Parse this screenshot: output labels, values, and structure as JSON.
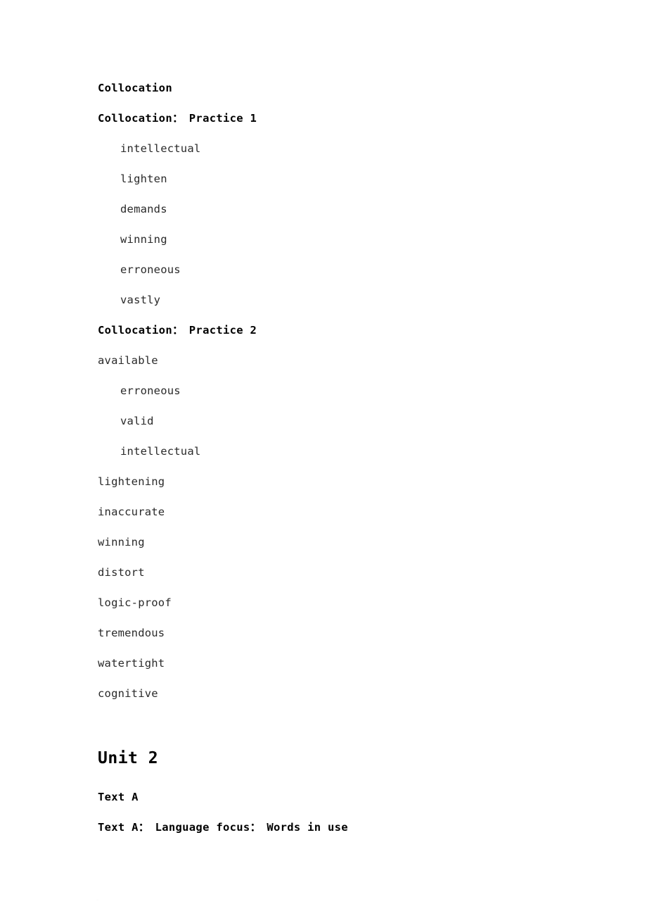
{
  "document": {
    "page_background": "#ffffff",
    "text_color": "#2a2a2a",
    "heading_color": "#000000"
  },
  "sections": [
    {
      "id": "collocation",
      "heading": "Collocation",
      "subsections": [
        {
          "id": "practice-1",
          "heading": "Collocation：　Practice 1",
          "items": [
            {
              "text": "intellectual",
              "indent": true
            },
            {
              "text": "lighten",
              "indent": true
            },
            {
              "text": "demands",
              "indent": true
            },
            {
              "text": "winning",
              "indent": true
            },
            {
              "text": "erroneous",
              "indent": true
            },
            {
              "text": "vastly",
              "indent": true
            }
          ]
        },
        {
          "id": "practice-2",
          "heading": "Collocation：　Practice 2",
          "items": [
            {
              "text": "available",
              "indent": false
            },
            {
              "text": "erroneous",
              "indent": true
            },
            {
              "text": "valid",
              "indent": true
            },
            {
              "text": "intellectual",
              "indent": true
            },
            {
              "text": "lightening",
              "indent": false
            },
            {
              "text": "inaccurate",
              "indent": false
            },
            {
              "text": "winning",
              "indent": false
            },
            {
              "text": "distort",
              "indent": false
            },
            {
              "text": "logic-proof",
              "indent": false
            },
            {
              "text": "tremendous",
              "indent": false
            },
            {
              "text": "watertight",
              "indent": false
            },
            {
              "text": "cognitive",
              "indent": false
            }
          ]
        }
      ]
    }
  ],
  "unit": {
    "title": "Unit 2",
    "text_a_heading": "Text A",
    "language_focus_heading": "Text A：　Language focus：　Words in use"
  },
  "footer": {
    "artifact": "■"
  }
}
